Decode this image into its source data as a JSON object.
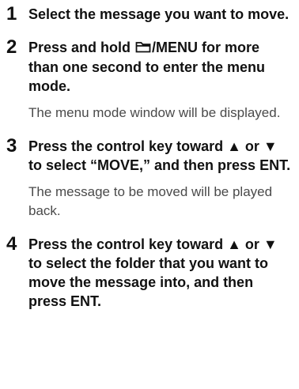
{
  "steps": [
    {
      "number": "1",
      "heading": "Select the message you want to move."
    },
    {
      "number": "2",
      "heading_before_icon": "Press and hold ",
      "icon": "folder-icon",
      "heading_after_icon": "/MENU for more than one second to enter the menu mode.",
      "description": "The menu mode window will be displayed."
    },
    {
      "number": "3",
      "heading": "Press the control key toward ▲ or ▼ to select “MOVE,” and then press ENT.",
      "description": "The message to be moved will be played back."
    },
    {
      "number": "4",
      "heading": "Press the control key toward ▲ or ▼ to select the folder that you want to move the message into, and then press ENT."
    }
  ]
}
